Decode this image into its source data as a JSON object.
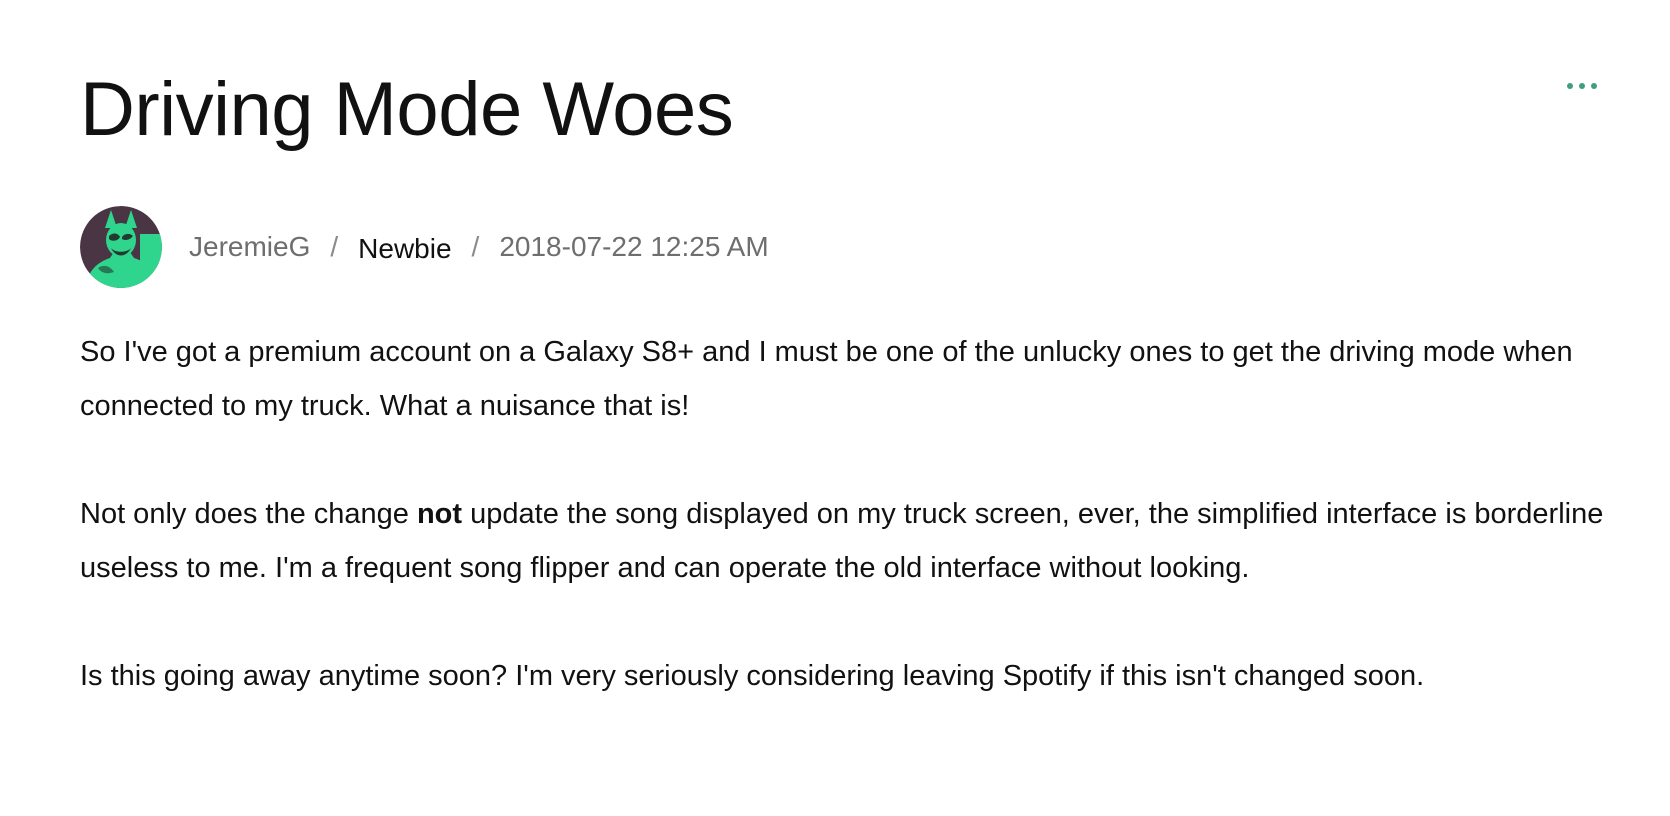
{
  "post": {
    "title": "Driving Mode Woes",
    "author": "JeremieG",
    "separator": "/",
    "rank": "Newbie",
    "timestamp": "2018-07-22 12:25 AM",
    "paragraphs": {
      "p1": "So I've got a premium account on a Galaxy S8+ and I must be one of the unlucky ones to get the driving mode when connected to my truck. What a nuisance that is!",
      "p2_before": "Not only does the change ",
      "p2_bold": "not",
      "p2_after": " update the song displayed on my truck screen, ever, the simplified interface is borderline useless to me. I'm a frequent song flipper and can operate the old interface without looking.",
      "p3": "Is this going away anytime soon? I'm very seriously considering leaving Spotify if this isn't changed soon."
    }
  },
  "icons": {
    "menu": "more-options-icon",
    "avatar": "user-avatar-image"
  },
  "colors": {
    "accent": "#3f9e80",
    "avatar_bg": "#4a3545",
    "avatar_figure": "#2fd58c",
    "muted_text": "#6e6e6e",
    "text": "#111111"
  }
}
